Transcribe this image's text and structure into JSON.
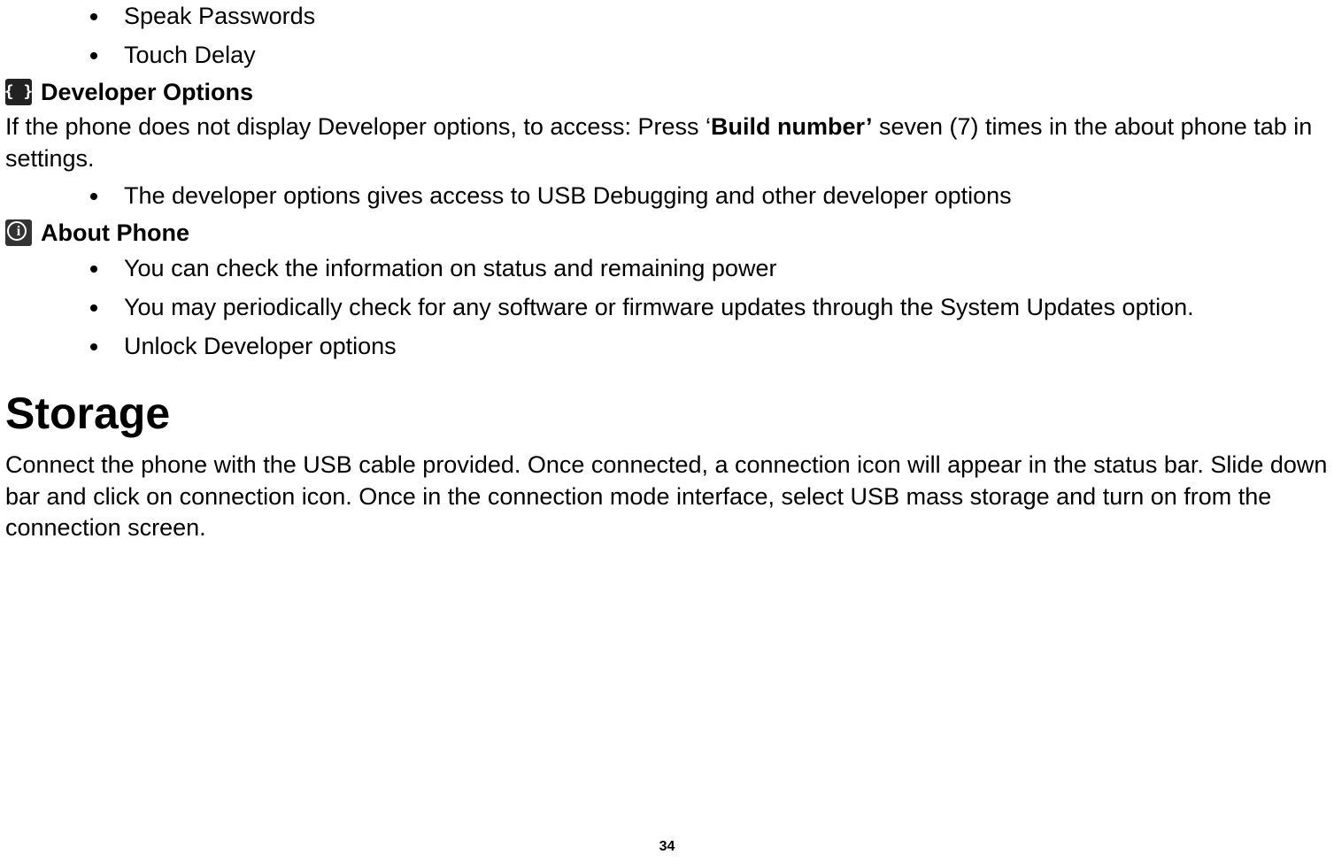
{
  "accessibility_bullets": [
    "Speak Passwords",
    "Touch Delay"
  ],
  "developer": {
    "label": "Developer Options",
    "intro_pre": "If the phone does not display Developer options, to access: Press ‘",
    "intro_bold": "Build number’",
    "intro_post": " seven (7) times in the about phone tab in settings.",
    "bullets": [
      "The developer options gives access to USB Debugging and other developer options"
    ]
  },
  "about": {
    "label": "About Phone",
    "bullets": [
      "You can check the information on status and remaining power",
      "You may periodically check for any software or firmware updates through the System Updates option.",
      "Unlock Developer options"
    ]
  },
  "storage": {
    "heading": "Storage",
    "para": "Connect the phone with the USB cable provided. Once connected, a connection icon will appear in the status bar. Slide down bar and click on connection icon. Once in the connection mode interface, select USB mass storage and turn on from the connection screen."
  },
  "page_number": "34"
}
